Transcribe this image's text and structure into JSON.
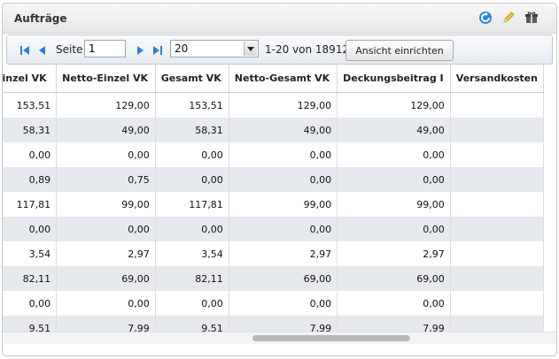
{
  "panel": {
    "title": "Aufträge",
    "tools": [
      {
        "name": "refresh-icon"
      },
      {
        "name": "pencil-icon"
      },
      {
        "name": "gift-icon"
      }
    ]
  },
  "toolbar": {
    "page_label": "Seite",
    "page_value": "1",
    "page_size": "20",
    "range_text": "1-20 von 18912",
    "view_button": "Ansicht einrichten"
  },
  "table": {
    "headers": [
      "Einzel VK",
      "Netto-Einzel VK",
      "Gesamt VK",
      "Netto-Gesamt VK",
      "Deckungsbeitrag I",
      "Versandkosten"
    ],
    "rows": [
      [
        "153,51",
        "129,00",
        "153,51",
        "129,00",
        "129,00",
        ""
      ],
      [
        "58,31",
        "49,00",
        "58,31",
        "49,00",
        "49,00",
        ""
      ],
      [
        "0,00",
        "0,00",
        "0,00",
        "0,00",
        "0,00",
        ""
      ],
      [
        "0,89",
        "0,75",
        "0,00",
        "0,00",
        "0,00",
        ""
      ],
      [
        "117,81",
        "99,00",
        "117,81",
        "99,00",
        "99,00",
        ""
      ],
      [
        "0,00",
        "0,00",
        "0,00",
        "0,00",
        "0,00",
        ""
      ],
      [
        "3,54",
        "2,97",
        "3,54",
        "2,97",
        "2,97",
        ""
      ],
      [
        "82,11",
        "69,00",
        "82,11",
        "69,00",
        "69,00",
        ""
      ],
      [
        "0,00",
        "0,00",
        "0,00",
        "0,00",
        "0,00",
        ""
      ],
      [
        "9,51",
        "7,99",
        "9,51",
        "7,99",
        "7,99",
        ""
      ],
      [
        "",
        "",
        "",
        "",
        "",
        ""
      ]
    ]
  }
}
